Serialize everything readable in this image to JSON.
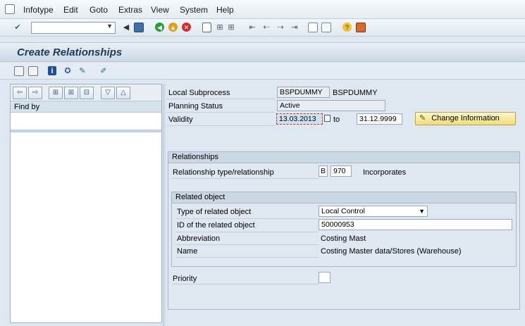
{
  "menubar": {
    "items": [
      {
        "label": "Infotype"
      },
      {
        "label": "Edit"
      },
      {
        "label": "Goto"
      },
      {
        "label": "Extras"
      },
      {
        "label": "View"
      },
      {
        "label": "System"
      },
      {
        "label": "Help"
      }
    ]
  },
  "toolbar": {
    "command_field_value": ""
  },
  "title": "Create Relationships",
  "left_pane": {
    "find_by_label": "Find by"
  },
  "header": {
    "local_subprocess_label": "Local Subprocess",
    "local_subprocess_code": "BSPDUMMY",
    "local_subprocess_name": "BSPDUMMY",
    "planning_status_label": "Planning Status",
    "planning_status_value": "Active",
    "validity_label": "Validity",
    "validity_from": "13.03.2013",
    "validity_to_label": "to",
    "validity_to": "31.12.9999",
    "change_info_button": "Change Information"
  },
  "relationships": {
    "group_title": "Relationships",
    "type_label": "Relationship type/relationship",
    "type_code": "B",
    "relationship_code": "970",
    "relationship_text": "Incorporates"
  },
  "related_object": {
    "group_title": "Related object",
    "type_label": "Type of related object",
    "type_value": "Local Control",
    "id_label": "ID of the related object",
    "id_value": "50000953",
    "abbr_label": "Abbreviation",
    "abbr_value": "Costing Mast",
    "name_label": "Name",
    "name_value": "Costing Master data/Stores (Warehouse)"
  },
  "priority": {
    "label": "Priority",
    "value": ""
  }
}
